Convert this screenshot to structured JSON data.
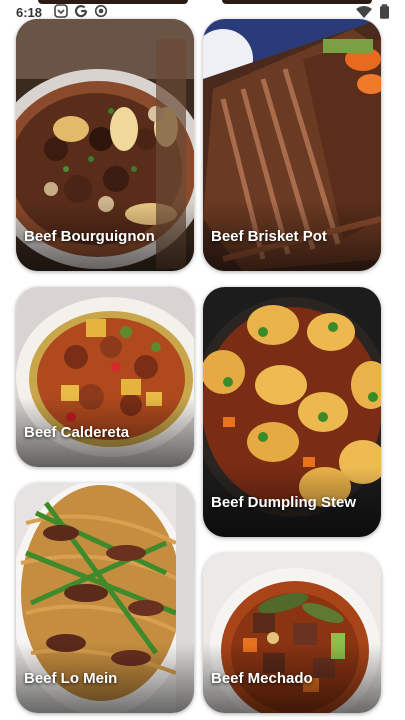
{
  "status_bar": {
    "time": "6:18",
    "left_icons": [
      "shield-notification-icon",
      "google-icon",
      "record-icon"
    ],
    "right_icons": [
      "wifi-icon",
      "battery-icon"
    ]
  },
  "recipes": [
    {
      "name": "Beef Bourguignon",
      "image": "beef-bourguignon-photo"
    },
    {
      "name": "Beef Brisket Pot",
      "image": "beef-brisket-photo"
    },
    {
      "name": "Beef Caldereta",
      "image": "beef-caldereta-photo"
    },
    {
      "name": "Beef Dumpling Stew",
      "image": "beef-dumpling-stew-photo"
    },
    {
      "name": "Beef Lo Mein",
      "image": "beef-lo-mein-photo"
    },
    {
      "name": "Beef Mechado",
      "image": "beef-mechado-photo"
    }
  ],
  "colors": {
    "background": "#ffffff",
    "label_text": "#ffffff"
  }
}
